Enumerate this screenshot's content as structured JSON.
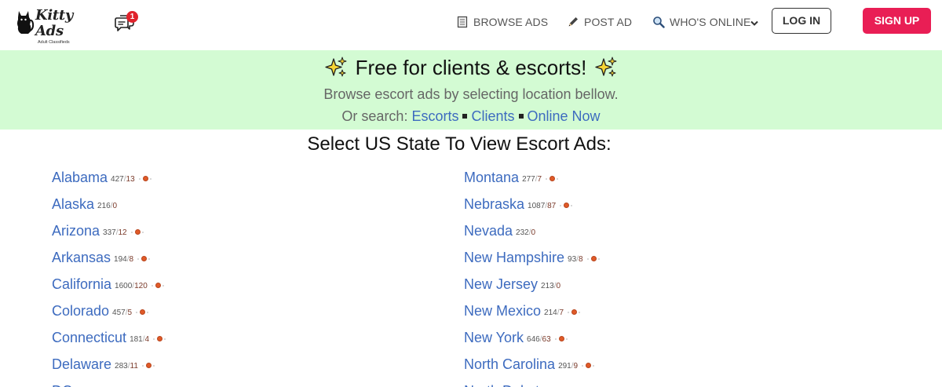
{
  "brand": {
    "name": "Kitty Ads",
    "tagline": "Adult Classifieds"
  },
  "header": {
    "messages_badge": "1",
    "nav": {
      "browse": "BROWSE ADS",
      "post": "POST AD",
      "online": "WHO'S ONLINE"
    },
    "login": "LOG IN",
    "signup": "SIGN UP"
  },
  "banner": {
    "title": "Free for clients & escorts!",
    "subtitle": "Browse escort ads by selecting location bellow.",
    "search_prefix": "Or search:",
    "links": [
      "Escorts",
      "Clients",
      "Online Now"
    ]
  },
  "heading": "Select US State To View Escort Ads:",
  "states_left": [
    {
      "name": "Alabama",
      "ads": "427",
      "online": "13",
      "has_online": true
    },
    {
      "name": "Alaska",
      "ads": "216",
      "online": "0",
      "has_online": false
    },
    {
      "name": "Arizona",
      "ads": "337",
      "online": "12",
      "has_online": true
    },
    {
      "name": "Arkansas",
      "ads": "194",
      "online": "8",
      "has_online": true
    },
    {
      "name": "California",
      "ads": "1600",
      "online": "120",
      "has_online": true
    },
    {
      "name": "Colorado",
      "ads": "457",
      "online": "5",
      "has_online": true
    },
    {
      "name": "Connecticut",
      "ads": "181",
      "online": "4",
      "has_online": true
    },
    {
      "name": "Delaware",
      "ads": "283",
      "online": "11",
      "has_online": true
    },
    {
      "name": "DC",
      "ads": "",
      "online": "",
      "has_online": false
    }
  ],
  "states_right": [
    {
      "name": "Montana",
      "ads": "277",
      "online": "7",
      "has_online": true
    },
    {
      "name": "Nebraska",
      "ads": "1087",
      "online": "87",
      "has_online": true
    },
    {
      "name": "Nevada",
      "ads": "232",
      "online": "0",
      "has_online": false
    },
    {
      "name": "New Hampshire",
      "ads": "93",
      "online": "8",
      "has_online": true
    },
    {
      "name": "New Jersey",
      "ads": "213",
      "online": "0",
      "has_online": false
    },
    {
      "name": "New Mexico",
      "ads": "214",
      "online": "7",
      "has_online": true
    },
    {
      "name": "New York",
      "ads": "646",
      "online": "63",
      "has_online": true
    },
    {
      "name": "North Carolina",
      "ads": "291",
      "online": "9",
      "has_online": true
    },
    {
      "name": "North Dakota",
      "ads": "",
      "online": "",
      "has_online": false
    }
  ],
  "colors": {
    "link": "#3d6bbf",
    "banner_bg": "#d3fbd3",
    "signup_bg": "#e91e55",
    "online_dot": "#e05a28",
    "badge": "#e0232c"
  },
  "icons": {
    "logo": "cat-icon",
    "messages": "chat-bubbles-icon",
    "browse": "document-icon",
    "post": "pencil-icon",
    "online": "magnifier-icon",
    "dropdown": "chevron-down-icon",
    "sparkle": "sparkles-icon"
  }
}
